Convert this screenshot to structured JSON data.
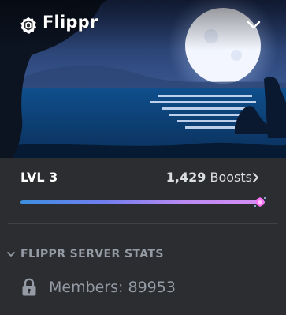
{
  "server": {
    "name": "Flippr"
  },
  "boost": {
    "level_label": "LVL 3",
    "boost_count": "1,429",
    "boost_word": "Boosts",
    "progress_fraction": 1.0
  },
  "stats_category": {
    "label": "FLIPPR SERVER STATS"
  },
  "stat_channel": {
    "label": "Members: 89953"
  },
  "colors": {
    "background": "#2b2d31",
    "progress_start": "#3d8fe0",
    "progress_end": "#d88ff5",
    "muted_text": "#949ba4"
  },
  "icons": [
    "verified-partner-badge-icon",
    "chevron-down-icon",
    "chevron-right-icon",
    "boost-gem-icon",
    "lock-icon"
  ]
}
